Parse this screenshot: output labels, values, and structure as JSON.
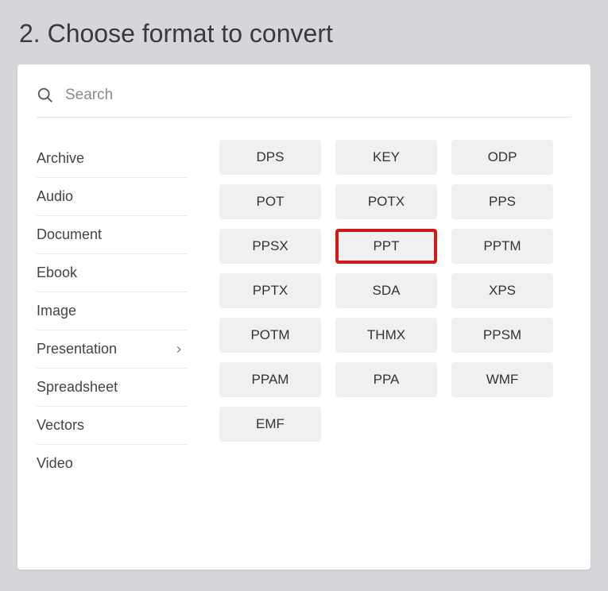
{
  "title": "2. Choose format to convert",
  "search": {
    "placeholder": "Search"
  },
  "sidebar": {
    "items": [
      {
        "label": "Archive",
        "active": false
      },
      {
        "label": "Audio",
        "active": false
      },
      {
        "label": "Document",
        "active": false
      },
      {
        "label": "Ebook",
        "active": false
      },
      {
        "label": "Image",
        "active": false
      },
      {
        "label": "Presentation",
        "active": true
      },
      {
        "label": "Spreadsheet",
        "active": false
      },
      {
        "label": "Vectors",
        "active": false
      },
      {
        "label": "Video",
        "active": false
      }
    ]
  },
  "formats": [
    {
      "label": "DPS",
      "highlight": false
    },
    {
      "label": "KEY",
      "highlight": false
    },
    {
      "label": "ODP",
      "highlight": false
    },
    {
      "label": "POT",
      "highlight": false
    },
    {
      "label": "POTX",
      "highlight": false
    },
    {
      "label": "PPS",
      "highlight": false
    },
    {
      "label": "PPSX",
      "highlight": false
    },
    {
      "label": "PPT",
      "highlight": true
    },
    {
      "label": "PPTM",
      "highlight": false
    },
    {
      "label": "PPTX",
      "highlight": false
    },
    {
      "label": "SDA",
      "highlight": false
    },
    {
      "label": "XPS",
      "highlight": false
    },
    {
      "label": "POTM",
      "highlight": false
    },
    {
      "label": "THMX",
      "highlight": false
    },
    {
      "label": "PPSM",
      "highlight": false
    },
    {
      "label": "PPAM",
      "highlight": false
    },
    {
      "label": "PPA",
      "highlight": false
    },
    {
      "label": "WMF",
      "highlight": false
    },
    {
      "label": "EMF",
      "highlight": false
    }
  ]
}
